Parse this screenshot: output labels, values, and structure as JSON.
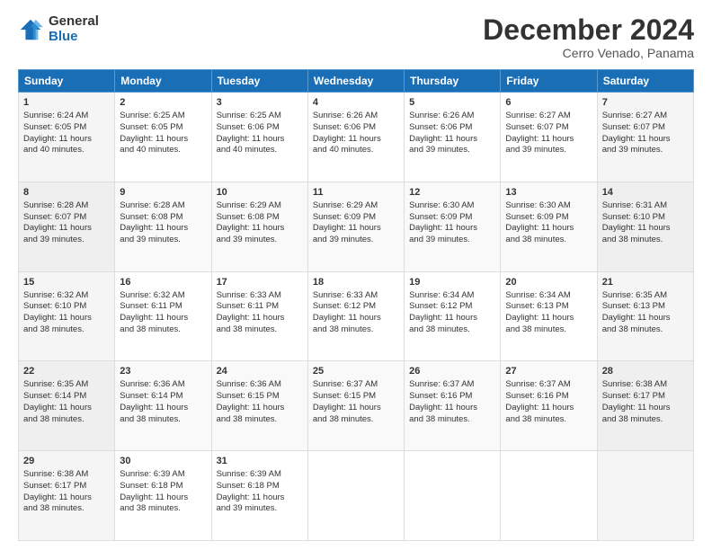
{
  "header": {
    "logo_general": "General",
    "logo_blue": "Blue",
    "title": "December 2024",
    "location": "Cerro Venado, Panama"
  },
  "days_of_week": [
    "Sunday",
    "Monday",
    "Tuesday",
    "Wednesday",
    "Thursday",
    "Friday",
    "Saturday"
  ],
  "weeks": [
    [
      {
        "day": "1",
        "lines": [
          "Sunrise: 6:24 AM",
          "Sunset: 6:05 PM",
          "Daylight: 11 hours",
          "and 40 minutes."
        ]
      },
      {
        "day": "2",
        "lines": [
          "Sunrise: 6:25 AM",
          "Sunset: 6:05 PM",
          "Daylight: 11 hours",
          "and 40 minutes."
        ]
      },
      {
        "day": "3",
        "lines": [
          "Sunrise: 6:25 AM",
          "Sunset: 6:06 PM",
          "Daylight: 11 hours",
          "and 40 minutes."
        ]
      },
      {
        "day": "4",
        "lines": [
          "Sunrise: 6:26 AM",
          "Sunset: 6:06 PM",
          "Daylight: 11 hours",
          "and 40 minutes."
        ]
      },
      {
        "day": "5",
        "lines": [
          "Sunrise: 6:26 AM",
          "Sunset: 6:06 PM",
          "Daylight: 11 hours",
          "and 39 minutes."
        ]
      },
      {
        "day": "6",
        "lines": [
          "Sunrise: 6:27 AM",
          "Sunset: 6:07 PM",
          "Daylight: 11 hours",
          "and 39 minutes."
        ]
      },
      {
        "day": "7",
        "lines": [
          "Sunrise: 6:27 AM",
          "Sunset: 6:07 PM",
          "Daylight: 11 hours",
          "and 39 minutes."
        ]
      }
    ],
    [
      {
        "day": "8",
        "lines": [
          "Sunrise: 6:28 AM",
          "Sunset: 6:07 PM",
          "Daylight: 11 hours",
          "and 39 minutes."
        ]
      },
      {
        "day": "9",
        "lines": [
          "Sunrise: 6:28 AM",
          "Sunset: 6:08 PM",
          "Daylight: 11 hours",
          "and 39 minutes."
        ]
      },
      {
        "day": "10",
        "lines": [
          "Sunrise: 6:29 AM",
          "Sunset: 6:08 PM",
          "Daylight: 11 hours",
          "and 39 minutes."
        ]
      },
      {
        "day": "11",
        "lines": [
          "Sunrise: 6:29 AM",
          "Sunset: 6:09 PM",
          "Daylight: 11 hours",
          "and 39 minutes."
        ]
      },
      {
        "day": "12",
        "lines": [
          "Sunrise: 6:30 AM",
          "Sunset: 6:09 PM",
          "Daylight: 11 hours",
          "and 39 minutes."
        ]
      },
      {
        "day": "13",
        "lines": [
          "Sunrise: 6:30 AM",
          "Sunset: 6:09 PM",
          "Daylight: 11 hours",
          "and 38 minutes."
        ]
      },
      {
        "day": "14",
        "lines": [
          "Sunrise: 6:31 AM",
          "Sunset: 6:10 PM",
          "Daylight: 11 hours",
          "and 38 minutes."
        ]
      }
    ],
    [
      {
        "day": "15",
        "lines": [
          "Sunrise: 6:32 AM",
          "Sunset: 6:10 PM",
          "Daylight: 11 hours",
          "and 38 minutes."
        ]
      },
      {
        "day": "16",
        "lines": [
          "Sunrise: 6:32 AM",
          "Sunset: 6:11 PM",
          "Daylight: 11 hours",
          "and 38 minutes."
        ]
      },
      {
        "day": "17",
        "lines": [
          "Sunrise: 6:33 AM",
          "Sunset: 6:11 PM",
          "Daylight: 11 hours",
          "and 38 minutes."
        ]
      },
      {
        "day": "18",
        "lines": [
          "Sunrise: 6:33 AM",
          "Sunset: 6:12 PM",
          "Daylight: 11 hours",
          "and 38 minutes."
        ]
      },
      {
        "day": "19",
        "lines": [
          "Sunrise: 6:34 AM",
          "Sunset: 6:12 PM",
          "Daylight: 11 hours",
          "and 38 minutes."
        ]
      },
      {
        "day": "20",
        "lines": [
          "Sunrise: 6:34 AM",
          "Sunset: 6:13 PM",
          "Daylight: 11 hours",
          "and 38 minutes."
        ]
      },
      {
        "day": "21",
        "lines": [
          "Sunrise: 6:35 AM",
          "Sunset: 6:13 PM",
          "Daylight: 11 hours",
          "and 38 minutes."
        ]
      }
    ],
    [
      {
        "day": "22",
        "lines": [
          "Sunrise: 6:35 AM",
          "Sunset: 6:14 PM",
          "Daylight: 11 hours",
          "and 38 minutes."
        ]
      },
      {
        "day": "23",
        "lines": [
          "Sunrise: 6:36 AM",
          "Sunset: 6:14 PM",
          "Daylight: 11 hours",
          "and 38 minutes."
        ]
      },
      {
        "day": "24",
        "lines": [
          "Sunrise: 6:36 AM",
          "Sunset: 6:15 PM",
          "Daylight: 11 hours",
          "and 38 minutes."
        ]
      },
      {
        "day": "25",
        "lines": [
          "Sunrise: 6:37 AM",
          "Sunset: 6:15 PM",
          "Daylight: 11 hours",
          "and 38 minutes."
        ]
      },
      {
        "day": "26",
        "lines": [
          "Sunrise: 6:37 AM",
          "Sunset: 6:16 PM",
          "Daylight: 11 hours",
          "and 38 minutes."
        ]
      },
      {
        "day": "27",
        "lines": [
          "Sunrise: 6:37 AM",
          "Sunset: 6:16 PM",
          "Daylight: 11 hours",
          "and 38 minutes."
        ]
      },
      {
        "day": "28",
        "lines": [
          "Sunrise: 6:38 AM",
          "Sunset: 6:17 PM",
          "Daylight: 11 hours",
          "and 38 minutes."
        ]
      }
    ],
    [
      {
        "day": "29",
        "lines": [
          "Sunrise: 6:38 AM",
          "Sunset: 6:17 PM",
          "Daylight: 11 hours",
          "and 38 minutes."
        ]
      },
      {
        "day": "30",
        "lines": [
          "Sunrise: 6:39 AM",
          "Sunset: 6:18 PM",
          "Daylight: 11 hours",
          "and 38 minutes."
        ]
      },
      {
        "day": "31",
        "lines": [
          "Sunrise: 6:39 AM",
          "Sunset: 6:18 PM",
          "Daylight: 11 hours",
          "and 39 minutes."
        ]
      },
      null,
      null,
      null,
      null
    ]
  ]
}
